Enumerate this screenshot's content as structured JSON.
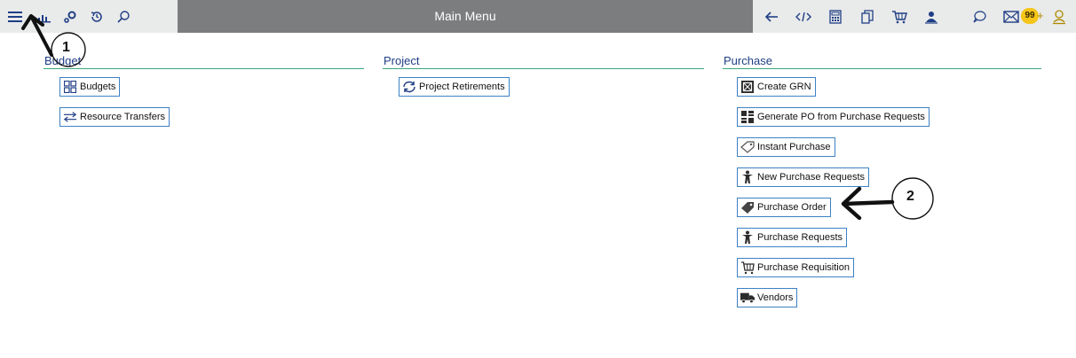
{
  "header": {
    "title": "Main Menu",
    "left_icons": [
      "menu-icon",
      "chart-icon",
      "settings-icon",
      "history-icon",
      "search-icon"
    ],
    "right_icons": [
      "back-arrow-icon",
      "code-icon",
      "calculator-icon",
      "copy-icon",
      "cart-icon",
      "user-group-icon",
      "chat-icon",
      "mail-icon",
      "user-icon"
    ],
    "mail_badge": "99",
    "mail_badge_plus": "+",
    "colors": {
      "title_bar": "#7b7d7f",
      "topbar": "#e9eaea",
      "badge": "#f5c518"
    }
  },
  "sections": {
    "budget": {
      "title": "Budget",
      "items": [
        {
          "label": "Budgets",
          "icon": "grid-icon"
        },
        {
          "label": "Resource Transfers",
          "icon": "transfer-icon"
        }
      ]
    },
    "project": {
      "title": "Project",
      "items": [
        {
          "label": "Project Retirements",
          "icon": "refresh-icon"
        }
      ]
    },
    "purchase": {
      "title": "Purchase",
      "items": [
        {
          "label": "Create GRN",
          "icon": "box-icon"
        },
        {
          "label": "Generate PO from Purchase Requests",
          "icon": "document-grid-icon"
        },
        {
          "label": "Instant Purchase",
          "icon": "tag-outline-icon"
        },
        {
          "label": "New Purchase Requests",
          "icon": "person-icon"
        },
        {
          "label": "Purchase Order",
          "icon": "tag-icon"
        },
        {
          "label": "Purchase Requests",
          "icon": "person-icon"
        },
        {
          "label": "Purchase Requisition",
          "icon": "cart-icon"
        },
        {
          "label": "Vendors",
          "icon": "truck-icon"
        }
      ]
    }
  },
  "annotations": {
    "first": "1",
    "second": "2"
  },
  "colors": {
    "section_underline": "#3aa67d",
    "section_title": "#1f3e85",
    "item_border": "#3d81c4"
  }
}
